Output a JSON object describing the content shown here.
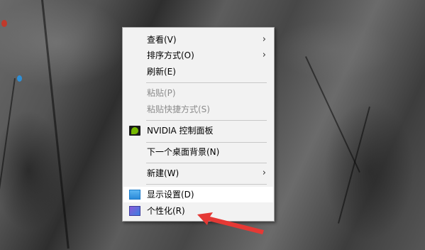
{
  "context_menu": {
    "items": [
      {
        "label": "查看(V)",
        "submenu": true
      },
      {
        "label": "排序方式(O)",
        "submenu": true
      },
      {
        "label": "刷新(E)"
      },
      {
        "label": "粘贴(P)",
        "disabled": true
      },
      {
        "label": "粘贴快捷方式(S)",
        "disabled": true
      },
      {
        "label": "NVIDIA 控制面板",
        "icon": "nvidia-icon"
      },
      {
        "label": "下一个桌面背景(N)"
      },
      {
        "label": "新建(W)",
        "submenu": true
      },
      {
        "label": "显示设置(D)",
        "icon": "display-settings-icon"
      },
      {
        "label": "个性化(R)",
        "icon": "personalize-icon"
      }
    ],
    "submenu_arrow": "›"
  },
  "annotation": {
    "arrow_color": "#e53935"
  }
}
